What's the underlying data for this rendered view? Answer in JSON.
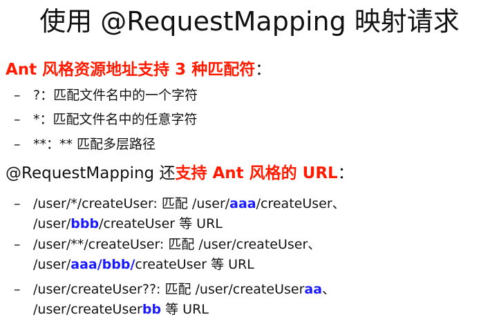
{
  "title": "使用 @RequestMapping 映射请求",
  "section1": {
    "heading_red": "Ant 风格资源地址支持 3 种匹配符",
    "heading_suffix": "：",
    "bullets": [
      "?：匹配文件名中的一个字符",
      "*：匹配文件名中的任意字符",
      "**：** 匹配多层路径"
    ]
  },
  "section2": {
    "heading_prefix": "@RequestMapping 还",
    "heading_red": "支持 Ant 风格的 URL",
    "heading_suffix": "：",
    "items": [
      {
        "l1_a": "/user/*/createUser: 匹配 /user/",
        "l1_hl": "aaa",
        "l1_b": "/createUser、",
        "l2_a": "/user/",
        "l2_hl": "bbb",
        "l2_b": "/createUser 等 URL"
      },
      {
        "l1_a": "/user/**/createUser: 匹配 /user/createUser、",
        "l2_a": "/user/",
        "l2_hl": "aaa/bbb/",
        "l2_b": "createUser 等 URL"
      },
      {
        "l1_a": "/user/createUser??: 匹配 /user/createUser",
        "l1_hl": "aa",
        "l1_b": "、",
        "l2_a": "/user/createUser",
        "l2_hl": "bb",
        "l2_b": " 等 URL"
      }
    ]
  },
  "bullet_dash": "–",
  "colors": {
    "highlight_red": "#ff1a00",
    "highlight_blue": "#1a1aff",
    "text": "#111111"
  }
}
